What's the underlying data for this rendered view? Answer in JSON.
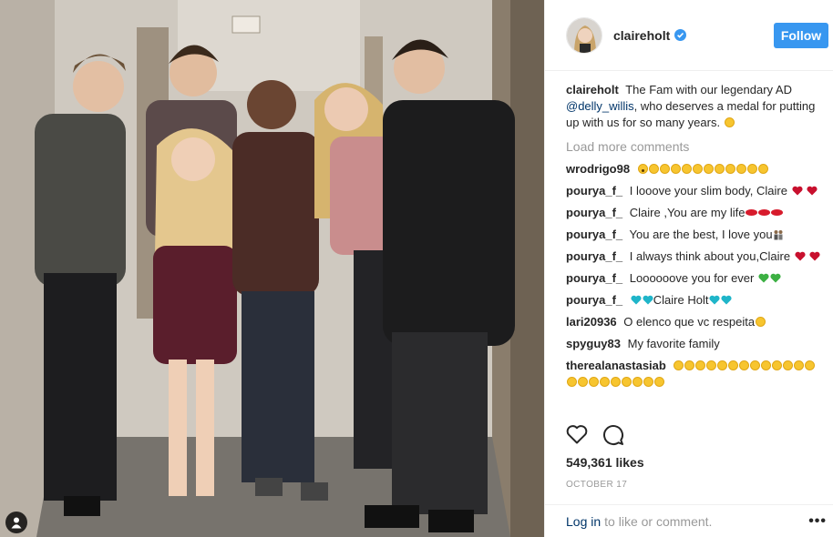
{
  "post": {
    "owner": "claireholt",
    "follow_label": "Follow",
    "caption_user": "claireholt",
    "caption_text_1": "The Fam with our legendary AD",
    "caption_mention": "@delly_willis",
    "caption_text_2": ", who deserves a medal for putting up with us for so many years.",
    "load_more": "Load more comments",
    "likes": "549,361 likes",
    "date": "October 17",
    "login_link": "Log in",
    "login_text": "to like or comment.",
    "more_options": "•••"
  },
  "comments": [
    {
      "user": "wrodrigo98",
      "text": ""
    },
    {
      "user": "pourya_f_",
      "text": "I looove your slim body, Claire"
    },
    {
      "user": "pourya_f_",
      "text": "Claire ,You are my life"
    },
    {
      "user": "pourya_f_",
      "text": "You are the best, I love you"
    },
    {
      "user": "pourya_f_",
      "text": "I always think about you,Claire"
    },
    {
      "user": "pourya_f_",
      "text": "Loooooove you for ever"
    },
    {
      "user": "pourya_f_",
      "text": "Claire Holt"
    },
    {
      "user": "lari20936",
      "text": "O elenco que vc respeita"
    },
    {
      "user": "spyguy83",
      "text": "My favorite family"
    },
    {
      "user": "therealanastasiab",
      "text": ""
    }
  ],
  "colors": {
    "follow": "#3897f0",
    "link": "#003569",
    "muted": "#999999",
    "text": "#262626",
    "verified": "#3897f0"
  },
  "icons": [
    "verified-badge-icon",
    "heart-icon",
    "comment-icon",
    "tagged-user-icon",
    "smile-emoji",
    "red-heart-emoji",
    "green-heart-emoji",
    "cyan-heart-emoji",
    "lips-emoji",
    "couple-emoji"
  ]
}
